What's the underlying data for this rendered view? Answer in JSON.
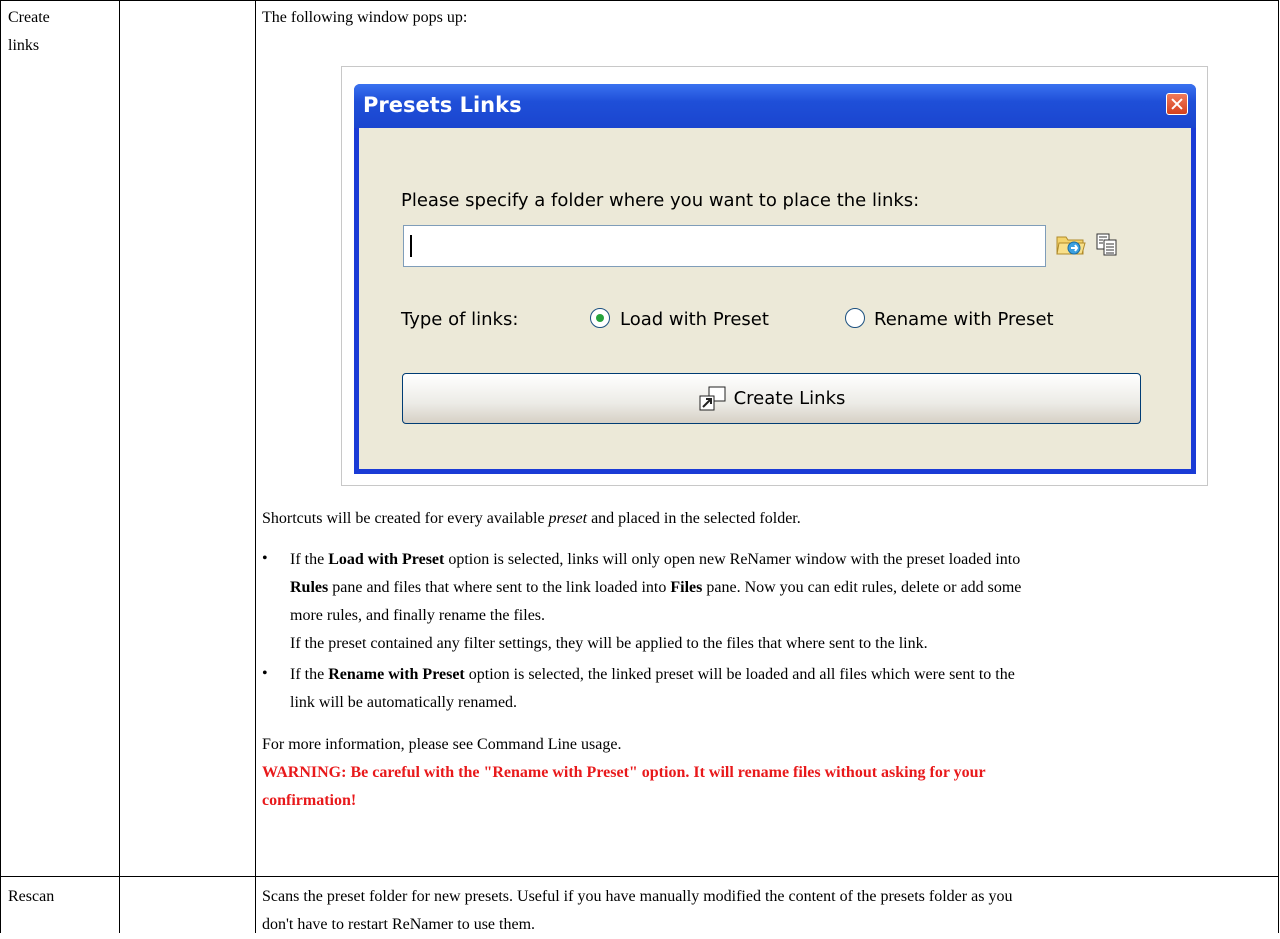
{
  "rows": [
    {
      "name": "Create links",
      "name_line1": "Create",
      "name_line2": "links"
    },
    {
      "name": "Rescan"
    }
  ],
  "create_links": {
    "intro": "The following window pops up:",
    "dialog": {
      "title": "Presets Links",
      "prompt": "Please specify a folder where you want to place the links:",
      "path_value": "",
      "type_label": "Type of links:",
      "option_load": "Load with Preset",
      "option_rename": "Rename with Preset",
      "selected_option": "Load with Preset",
      "create_button": "Create Links",
      "icons": [
        "close-icon",
        "browse-folder-icon",
        "copy-icon",
        "create-links-icon"
      ]
    },
    "shortcuts_pre": "Shortcuts will be created for every available ",
    "shortcuts_em": "preset",
    "shortcuts_post": " and placed in the selected folder.",
    "bullet1": {
      "pre": "If the ",
      "b1": "Load with Preset",
      "mid1": " option is selected, links will only open new ReNamer window with the preset loaded into",
      "b2": "Rules",
      "mid2": " pane and files that where sent to the link loaded into ",
      "b3": "Files",
      "mid3": " pane. Now you can edit rules, delete or add some",
      "line3": "more rules, and finally rename the files.",
      "line4": "If the preset contained any filter settings, they will be applied to the files that where sent to the link."
    },
    "bullet2": {
      "pre": "If the ",
      "b1": "Rename with Preset",
      "mid1": " option is selected, the linked preset will be loaded and all files which were sent to the",
      "line2": "link will be automatically renamed."
    },
    "more_info": "For more information, please see Command Line usage.",
    "warning_line1": "WARNING: Be careful with the \"Rename with Preset\" option. It will rename files without asking for your",
    "warning_line2": "confirmation!"
  },
  "rescan": {
    "line1": "Scans the preset folder for new presets. Useful if you have manually modified the content of the presets folder as you",
    "line2": "don't have to restart ReNamer to use them."
  },
  "colors": {
    "warning": "#e8191b",
    "titlebar": "#1f4fd8",
    "dialog_bg": "#ece9d8"
  }
}
